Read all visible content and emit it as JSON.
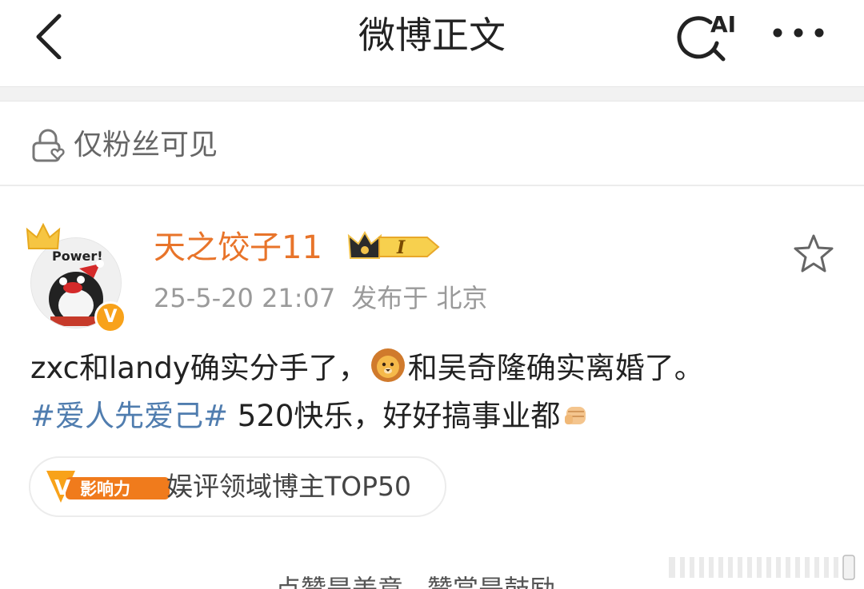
{
  "nav": {
    "title": "微博正文",
    "ai_label": "AI"
  },
  "visibility": {
    "text": "仅粉丝可见"
  },
  "post": {
    "author": {
      "name": "天之饺子11",
      "avatar_text": "Power!",
      "verified_letter": "V"
    },
    "level_badge_text": "I",
    "timestamp": "25-5-20 21:07",
    "location": "发布于 北京",
    "content": {
      "line1_part1": "zxc和landy确实分手了，",
      "line1_part2": "和吴奇隆确实离婚了。",
      "hashtag": "#爱人先爱己#",
      "line2_rest": " 520快乐，好好搞事业都"
    },
    "influence": {
      "logo_letter": "V",
      "logo_text": "影响力",
      "label": "娱评领域博主TOP50"
    }
  },
  "bottom": {
    "left_text": "点赞是美意",
    "right_text": "赞赏是鼓励"
  },
  "colors": {
    "username": "#e8742a",
    "hashtag": "#507daf",
    "meta": "#9a9a9a"
  }
}
